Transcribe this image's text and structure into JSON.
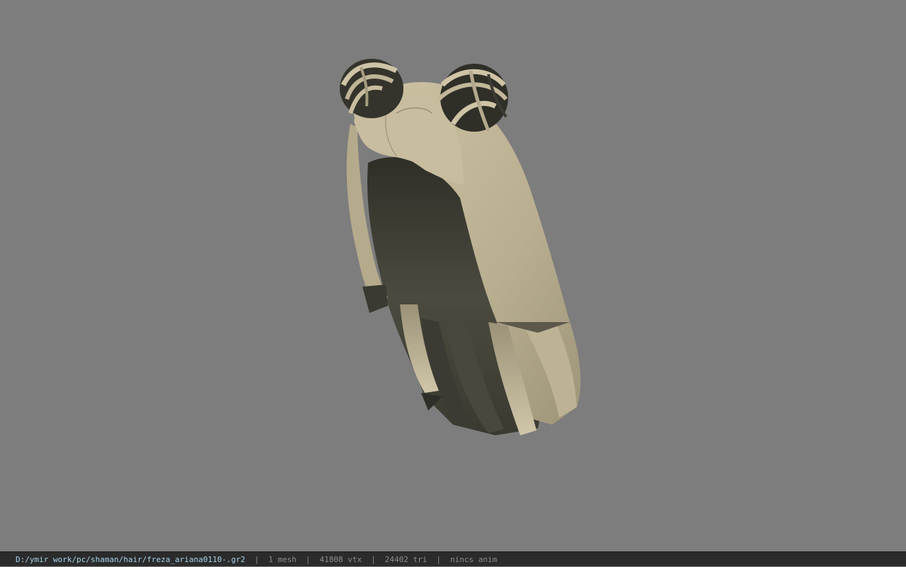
{
  "viewport": {
    "background": "#7d7d7d",
    "model_colors": {
      "light": "#c7bb9d",
      "mid": "#a99e82",
      "dark": "#45443a",
      "darker": "#34342c"
    }
  },
  "statusbar": {
    "file_path": "D:/ymir work/pc/shaman/hair/freza_ariana0110-.gr2",
    "separator": "|",
    "mesh": "1 mesh",
    "vertices": "41808 vtx",
    "triangles": "24402 tri",
    "anim": "nincs anim",
    "path_color": "#a8d4ea"
  }
}
